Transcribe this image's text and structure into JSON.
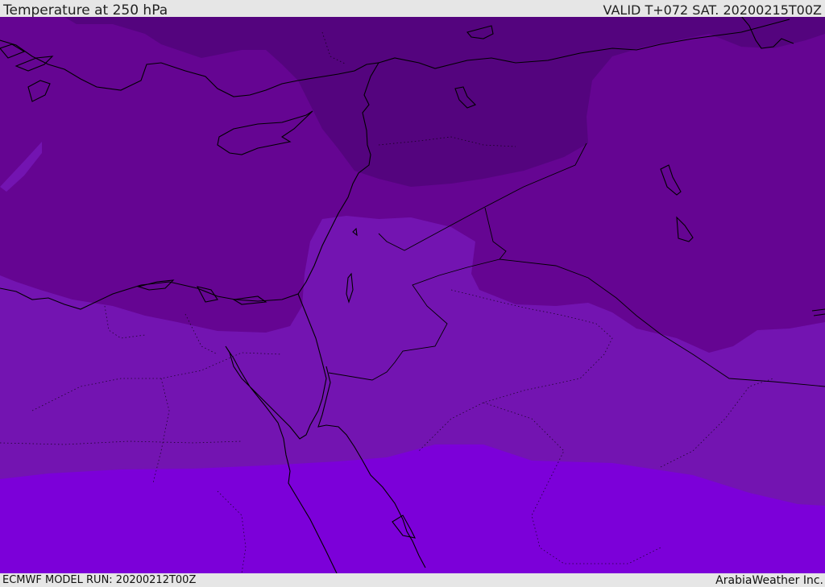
{
  "header": {
    "title": "Temperature at 250 hPa",
    "valid": "VALID T+072 SAT. 20200215T00Z"
  },
  "footer": {
    "model_run": "ECMWF MODEL RUN: 20200212T00Z",
    "credit": "ArabiaWeather Inc."
  },
  "colors": {
    "band_coldest": "#54047e",
    "band_cold": "#650592",
    "band_mid": "#7314b1",
    "band_warm": "#7c00d9",
    "coastline": "#000000"
  }
}
